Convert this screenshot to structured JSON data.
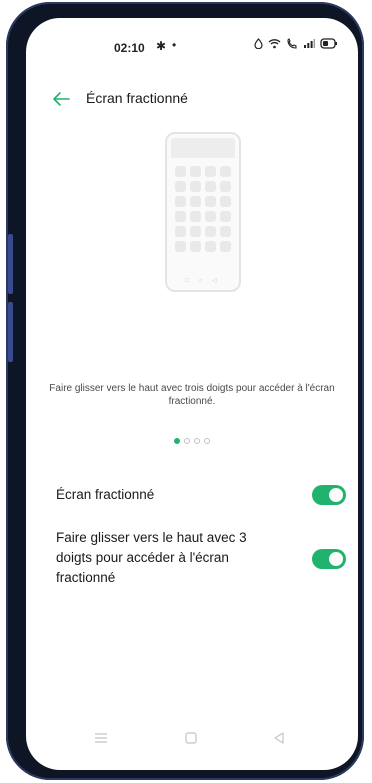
{
  "status_bar": {
    "time": "02:10",
    "settings_icon": "gear-icon",
    "dot": "•",
    "icons": [
      "drop-icon",
      "wifi-icon",
      "wifi-calling-icon",
      "signal-icon",
      "battery-icon"
    ]
  },
  "header": {
    "back_icon": "back-arrow-icon",
    "title": "Écran fractionné"
  },
  "illustration": {
    "icon": "phone-illustration"
  },
  "caption": "Faire glisser vers le haut avec trois doigts pour accéder à l'écran fractionné.",
  "pager": {
    "count": 4,
    "active_index": 0
  },
  "settings": [
    {
      "label": "Écran fractionné",
      "enabled": true
    },
    {
      "label": "Faire glisser vers le haut avec 3 doigts pour accéder à l'écran fractionné",
      "enabled": true
    }
  ],
  "nav_bar": {
    "buttons": [
      "menu-icon",
      "home-icon",
      "back-icon"
    ]
  },
  "colors": {
    "accent": "#1fb36e",
    "frame": "#0e1524",
    "text": "#1a1a1a"
  }
}
